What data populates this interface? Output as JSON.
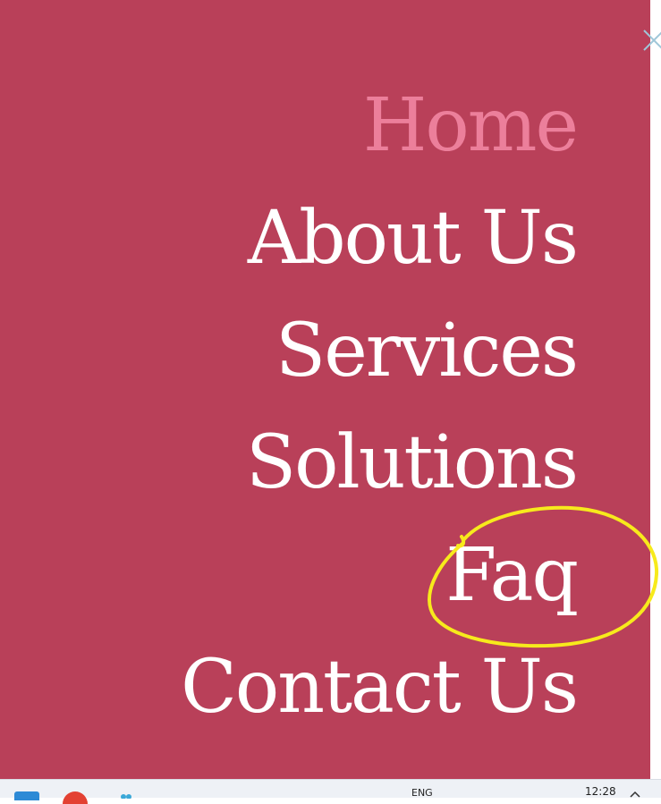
{
  "menu": {
    "items": [
      {
        "label": "Home",
        "active": true
      },
      {
        "label": "About Us",
        "active": false
      },
      {
        "label": "Services",
        "active": false
      },
      {
        "label": "Solutions",
        "active": false
      },
      {
        "label": "Faq",
        "active": false
      },
      {
        "label": "Contact Us",
        "active": false
      }
    ]
  },
  "taskbar": {
    "language": "ENG",
    "time": "12:28"
  },
  "colors": {
    "panel_background": "#b94059",
    "active_item": "#ec7f9b",
    "item_text": "#ffffff",
    "annotation_circle": "#f7ea1c",
    "close_icon": "#9fc6d8"
  },
  "icons": {
    "close": "close-icon",
    "taskbar": [
      "file-explorer-icon",
      "chrome-icon",
      "app-icon"
    ],
    "tray": "chevron-up-icon"
  }
}
